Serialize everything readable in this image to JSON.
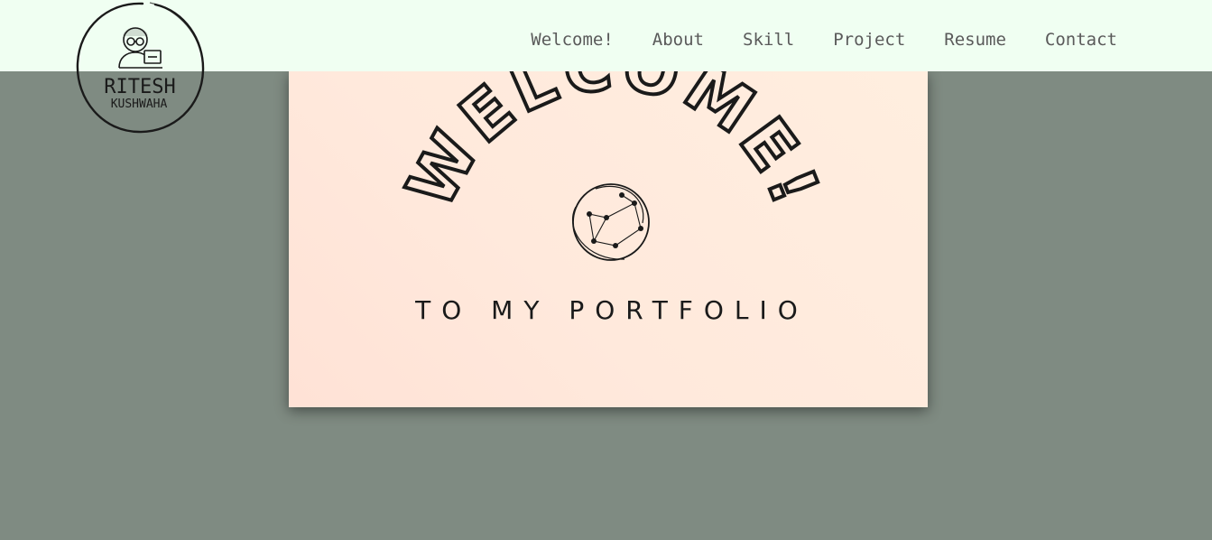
{
  "logo": {
    "name_line1": "RITESH",
    "name_line2": "KUSHWAHA",
    "icon": "developer-avatar-icon"
  },
  "nav": {
    "items": [
      {
        "label": "Welcome!"
      },
      {
        "label": "About"
      },
      {
        "label": "Skill"
      },
      {
        "label": "Project"
      },
      {
        "label": "Resume"
      },
      {
        "label": "Contact"
      }
    ]
  },
  "hero": {
    "heading": "WELCOME!",
    "tagline": "TO MY PORTFOLIO",
    "icon": "globe-network-icon"
  },
  "colors": {
    "page_background": "#7f8b82",
    "navbar_background": "#f0fff2",
    "card_background": "#ffe9dc",
    "nav_text": "#5a5a5a",
    "ink": "#1a1a1a"
  }
}
